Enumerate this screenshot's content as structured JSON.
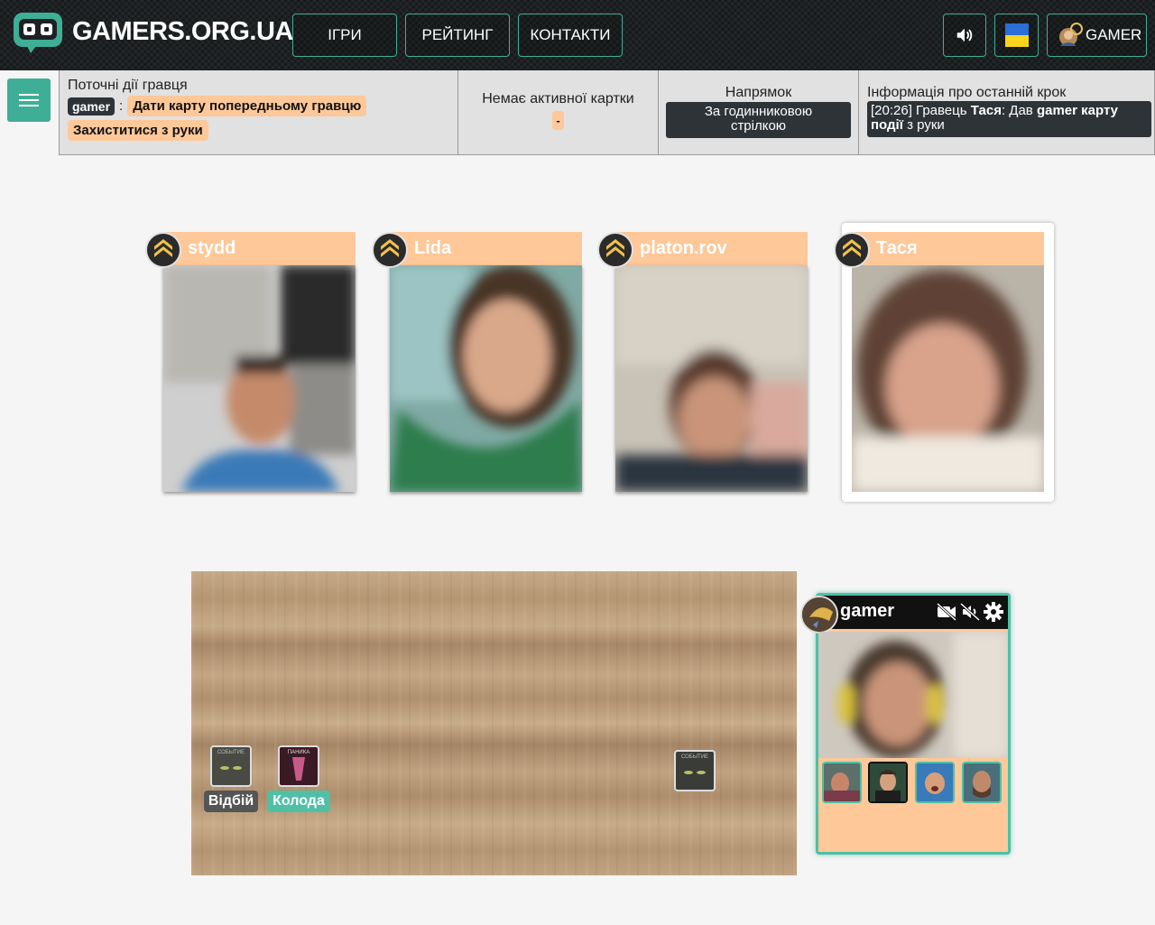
{
  "header": {
    "logo_text": "GAMERS.ORG.UA",
    "nav": [
      {
        "label": "ІГРИ"
      },
      {
        "label": "РЕЙТИНГ"
      },
      {
        "label": "КОНТАКТИ"
      }
    ],
    "user_label": "GAMER",
    "icons": [
      "sound-icon",
      "ukraine-flag-icon",
      "user-avatar-icon"
    ]
  },
  "status": {
    "actions": {
      "title": "Поточні дії гравця",
      "player": "gamer",
      "separator": ":",
      "action1": "Дати карту попередньому гравцю",
      "action2": "Захиститися з руки"
    },
    "card": {
      "title": "Немає активної картки",
      "value": "-"
    },
    "direction": {
      "title": "Напрямок",
      "value": "За годинниковою стрілкою"
    },
    "last_step": {
      "title": "Інформація про останній крок",
      "time": "[20:26]",
      "text1": " Гравець ",
      "player": "Тася",
      "text2": ": Дав ",
      "bold2": "gamer карту події",
      "text3": " з руки"
    }
  },
  "players": [
    {
      "name": "stydd"
    },
    {
      "name": "Lida"
    },
    {
      "name": "platon.rov"
    },
    {
      "name": "Тася",
      "active": true
    }
  ],
  "table": {
    "discard_label": "Відбій",
    "deck_label": "Колода",
    "discard_card_text": "СОБЫТИЕ",
    "deck_card_text": "ПАНИКА",
    "played_card_text": "СОБЫТИЕ"
  },
  "self": {
    "name": "gamer",
    "icons": [
      "camera-off-icon",
      "mic-off-icon",
      "settings-gear-icon"
    ],
    "hand_count": 4
  },
  "colors": {
    "accent": "#3fae96",
    "peach": "#fec899",
    "dark": "#2e3338"
  }
}
